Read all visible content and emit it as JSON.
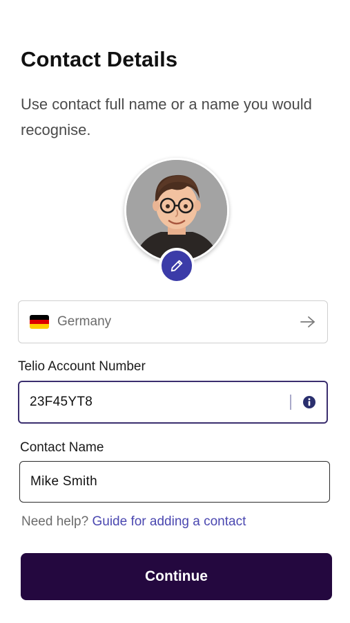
{
  "header": {
    "title": "Contact Details",
    "subtitle": "Use contact full name or a name you would recognise."
  },
  "avatar": {
    "edit_icon": "pencil-icon",
    "accent_color": "#3b3ba8"
  },
  "country": {
    "name": "Germany",
    "flag_icon": "germany-flag-icon",
    "arrow_icon": "arrow-right-icon"
  },
  "account": {
    "label": "Telio Account Number",
    "value": "23F45YT8",
    "info_icon": "info-icon"
  },
  "contact_name": {
    "label": "Contact Name",
    "value": "Mike Smith"
  },
  "help": {
    "prefix": "Need help?",
    "link": "Guide for adding a contact"
  },
  "actions": {
    "continue_label": "Continue",
    "primary_color": "#24083f"
  }
}
